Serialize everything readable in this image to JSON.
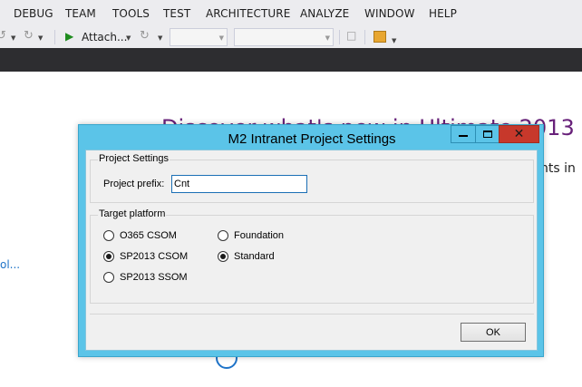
{
  "menu": {
    "items": [
      "DEBUG",
      "TEAM",
      "TOOLS",
      "TEST",
      "ARCHITECTURE",
      "ANALYZE",
      "WINDOW",
      "HELP"
    ]
  },
  "toolbar": {
    "attach_label": "Attach...",
    "icons": [
      "undo-icon",
      "redo-icon",
      "play-icon",
      "refresh-icon",
      "window-icon",
      "extensions-icon"
    ]
  },
  "background": {
    "heading_visible": "Discover what's new in Ultimate 2013",
    "fragment": "nts in",
    "link": "ol..."
  },
  "dialog": {
    "title": "M2 Intranet Project Settings",
    "project_settings": {
      "group_label": "Project Settings",
      "prefix_label": "Project prefix:",
      "prefix_value": "Cnt"
    },
    "target_platform": {
      "group_label": "Target platform",
      "options": [
        {
          "label": "O365 CSOM",
          "checked": false
        },
        {
          "label": "SP2013 CSOM",
          "checked": true
        },
        {
          "label": "SP2013 SSOM",
          "checked": false
        },
        {
          "label": "Foundation",
          "checked": false
        },
        {
          "label": "Standard",
          "checked": true
        }
      ]
    },
    "ok_label": "OK"
  },
  "colors": {
    "dialog_frame": "#5bc4e8",
    "close_button": "#c7382b",
    "vs_chrome": "#ececef",
    "vs_dark": "#2d2d30",
    "heading": "#68217a",
    "link": "#1e73c8"
  }
}
